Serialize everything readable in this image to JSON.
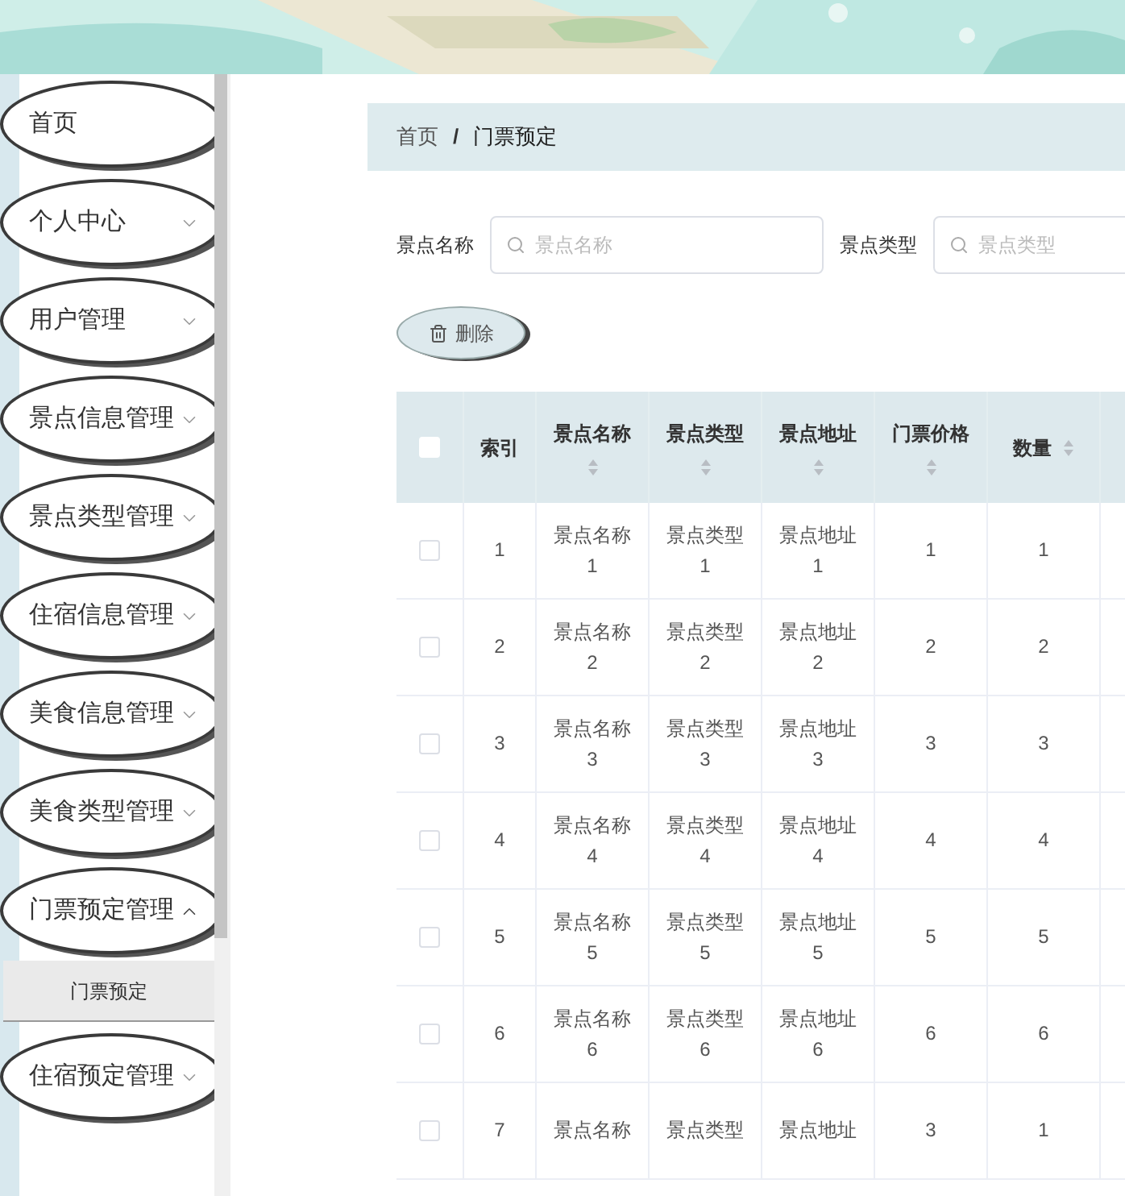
{
  "sidebar": {
    "items": [
      {
        "label": "首页",
        "has_children": false
      },
      {
        "label": "个人中心",
        "has_children": true,
        "expanded": false
      },
      {
        "label": "用户管理",
        "has_children": true,
        "expanded": false
      },
      {
        "label": "景点信息管理",
        "has_children": true,
        "expanded": false
      },
      {
        "label": "景点类型管理",
        "has_children": true,
        "expanded": false
      },
      {
        "label": "住宿信息管理",
        "has_children": true,
        "expanded": false
      },
      {
        "label": "美食信息管理",
        "has_children": true,
        "expanded": false
      },
      {
        "label": "美食类型管理",
        "has_children": true,
        "expanded": false
      },
      {
        "label": "门票预定管理",
        "has_children": true,
        "expanded": true,
        "children": [
          {
            "label": "门票预定",
            "selected": true
          }
        ]
      },
      {
        "label": "住宿预定管理",
        "has_children": true,
        "expanded": false
      }
    ]
  },
  "breadcrumb": [
    "首页",
    "/",
    "门票预定"
  ],
  "filters": [
    {
      "label": "景点名称",
      "placeholder": "景点名称"
    },
    {
      "label": "景点类型",
      "placeholder": "景点类型"
    }
  ],
  "delete_button": "删除",
  "table": {
    "select_all": {
      "checked": false
    },
    "columns": [
      {
        "label": "索引",
        "sortable": false
      },
      {
        "label": "景点名称",
        "sortable": true
      },
      {
        "label": "景点类型",
        "sortable": true
      },
      {
        "label": "景点地址",
        "sortable": true
      },
      {
        "label": "门票价格",
        "sortable": true
      },
      {
        "label": "数量",
        "sortable": true
      }
    ],
    "rows": [
      {
        "checked": false,
        "cells": [
          [
            "1"
          ],
          [
            "景点名称",
            "1"
          ],
          [
            "景点类型",
            "1"
          ],
          [
            "景点地址",
            "1"
          ],
          [
            "1"
          ],
          [
            "1"
          ]
        ]
      },
      {
        "checked": false,
        "cells": [
          [
            "2"
          ],
          [
            "景点名称",
            "2"
          ],
          [
            "景点类型",
            "2"
          ],
          [
            "景点地址",
            "2"
          ],
          [
            "2"
          ],
          [
            "2"
          ]
        ]
      },
      {
        "checked": false,
        "cells": [
          [
            "3"
          ],
          [
            "景点名称",
            "3"
          ],
          [
            "景点类型",
            "3"
          ],
          [
            "景点地址",
            "3"
          ],
          [
            "3"
          ],
          [
            "3"
          ]
        ]
      },
      {
        "checked": false,
        "cells": [
          [
            "4"
          ],
          [
            "景点名称",
            "4"
          ],
          [
            "景点类型",
            "4"
          ],
          [
            "景点地址",
            "4"
          ],
          [
            "4"
          ],
          [
            "4"
          ]
        ]
      },
      {
        "checked": false,
        "cells": [
          [
            "5"
          ],
          [
            "景点名称",
            "5"
          ],
          [
            "景点类型",
            "5"
          ],
          [
            "景点地址",
            "5"
          ],
          [
            "5"
          ],
          [
            "5"
          ]
        ]
      },
      {
        "checked": false,
        "cells": [
          [
            "6"
          ],
          [
            "景点名称",
            "6"
          ],
          [
            "景点类型",
            "6"
          ],
          [
            "景点地址",
            "6"
          ],
          [
            "6"
          ],
          [
            "6"
          ]
        ]
      },
      {
        "checked": false,
        "cells": [
          [
            "7"
          ],
          [
            "景点名称"
          ],
          [
            "景点类型"
          ],
          [
            "景点地址"
          ],
          [
            "3"
          ],
          [
            "1"
          ]
        ]
      }
    ]
  }
}
